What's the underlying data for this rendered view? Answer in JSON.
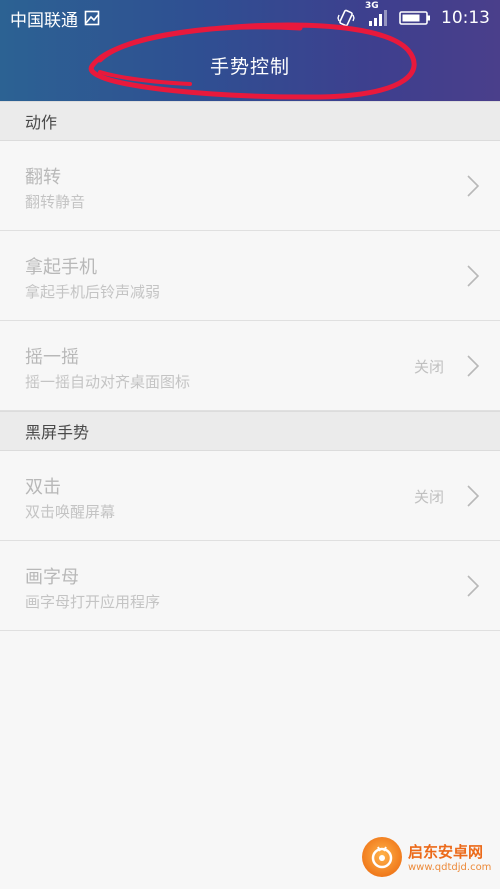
{
  "status_bar": {
    "carrier": "中国联通",
    "network": "3G",
    "time": "10:13"
  },
  "header": {
    "title": "手势控制"
  },
  "sections": [
    {
      "header": "动作",
      "items": [
        {
          "title": "翻转",
          "subtitle": "翻转静音",
          "value": ""
        },
        {
          "title": "拿起手机",
          "subtitle": "拿起手机后铃声减弱",
          "value": ""
        },
        {
          "title": "摇一摇",
          "subtitle": "摇一摇自动对齐桌面图标",
          "value": "关闭"
        }
      ]
    },
    {
      "header": "黑屏手势",
      "items": [
        {
          "title": "双击",
          "subtitle": "双击唤醒屏幕",
          "value": "关闭"
        },
        {
          "title": "画字母",
          "subtitle": "画字母打开应用程序",
          "value": ""
        }
      ]
    }
  ],
  "watermark": {
    "name": "启东安卓网",
    "url": "www.qdtdjd.com"
  },
  "colors": {
    "header_start": "#2c6293",
    "header_end": "#4a3f8b",
    "annotation": "#e8193c"
  }
}
